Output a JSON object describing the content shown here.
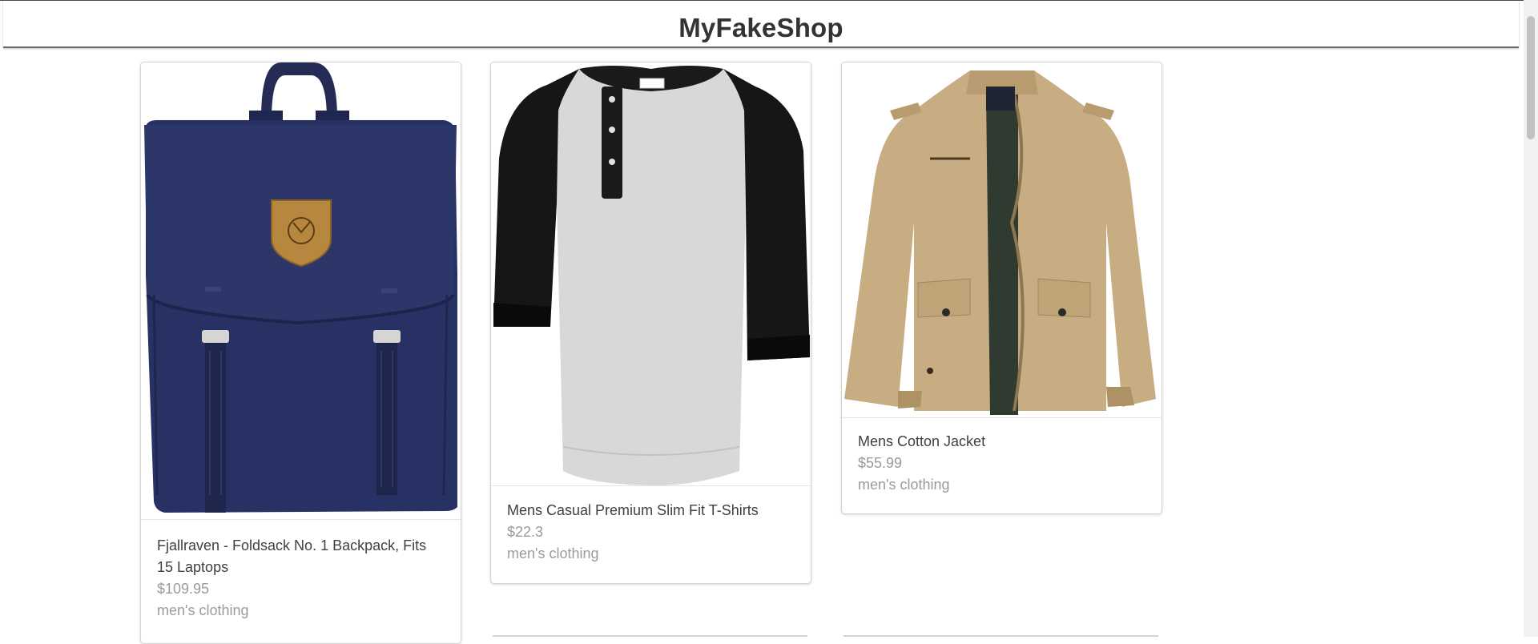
{
  "header": {
    "title": "MyFakeShop"
  },
  "products": [
    {
      "title": "Fjallraven - Foldsack No. 1 Backpack, Fits 15 Laptops",
      "price": "$109.95",
      "category": "men's clothing",
      "image": "navy-backpack-image"
    },
    {
      "title": "Mens Casual Premium Slim Fit T-Shirts",
      "price": "$22.3",
      "category": "men's clothing",
      "image": "raglan-henley-tshirt-image"
    },
    {
      "title": "Mens Cotton Jacket",
      "price": "$55.99",
      "category": "men's clothing",
      "image": "khaki-cotton-jacket-image"
    }
  ],
  "colors": {
    "backpack": "#26305c",
    "tshirt_body": "#d9d9d9",
    "tshirt_sleeve": "#1a1a1a",
    "jacket": "#c9ae84",
    "price_text": "#9b9b9b",
    "title_text": "#404040"
  }
}
